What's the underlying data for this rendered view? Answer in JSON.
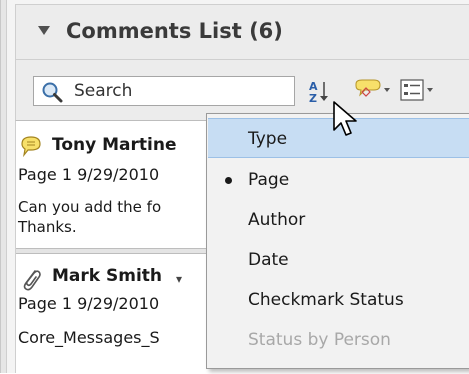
{
  "panel": {
    "title": "Comments List (6)"
  },
  "search": {
    "placeholder": "Search"
  },
  "toolbar": {
    "sort_icon": "sort-az-icon",
    "filter_icon": "comment-filter-icon",
    "options_icon": "list-options-icon"
  },
  "comments": [
    {
      "author": "Tony Martine",
      "meta": "Page 1  9/29/2010",
      "body_line1": "Can you add the fo",
      "body_line2": "Thanks.",
      "icon": "speech-bubble-icon"
    },
    {
      "author": "Mark Smith",
      "meta": "Page 1  9/29/2010",
      "body_line1": "Core_Messages_S",
      "icon": "paperclip-icon"
    }
  ],
  "sort_menu": {
    "items": [
      {
        "label": "Type",
        "highlighted": true,
        "selected": false,
        "enabled": true
      },
      {
        "label": "Page",
        "highlighted": false,
        "selected": true,
        "enabled": true
      },
      {
        "label": "Author",
        "highlighted": false,
        "selected": false,
        "enabled": true
      },
      {
        "label": "Date",
        "highlighted": false,
        "selected": false,
        "enabled": true
      },
      {
        "label": "Checkmark Status",
        "highlighted": false,
        "selected": false,
        "enabled": true
      },
      {
        "label": "Status by Person",
        "highlighted": false,
        "selected": false,
        "enabled": false
      }
    ]
  },
  "colors": {
    "highlight": "#c7ddf3",
    "disabled_text": "#a8a8a8",
    "bubble_yellow": "#f7e06a"
  }
}
